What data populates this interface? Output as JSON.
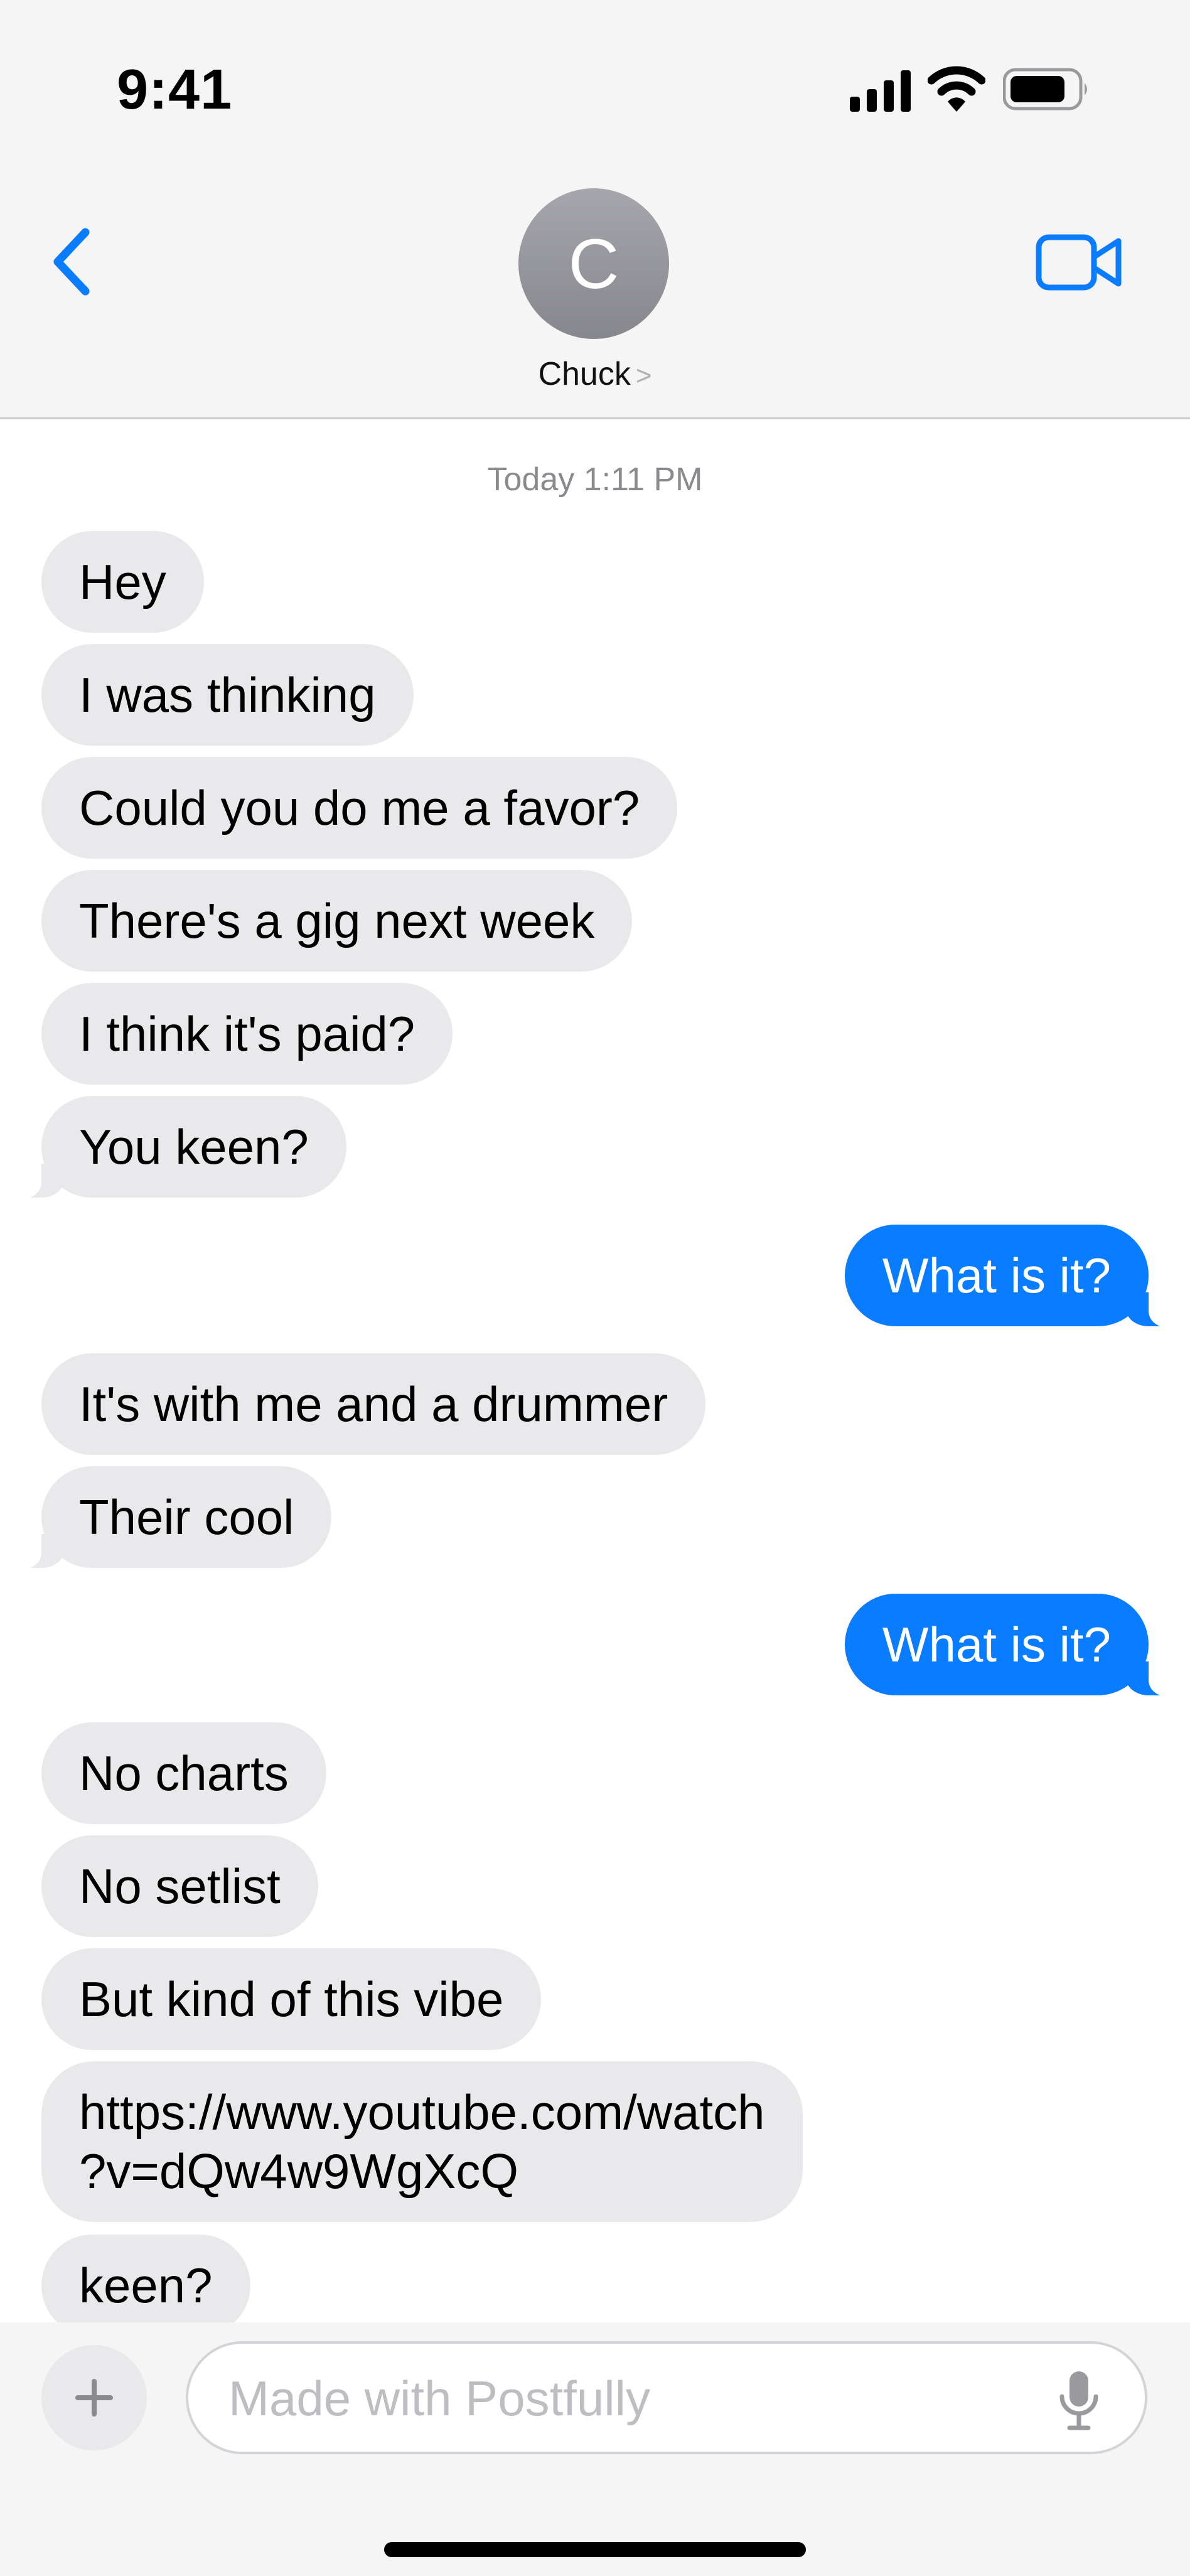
{
  "status_bar": {
    "time": "9:41"
  },
  "header": {
    "avatar_initial": "C",
    "contact_name": "Chuck",
    "contact_chevron": ">"
  },
  "thread": {
    "timestamp": "Today 1:11 PM",
    "messages": [
      {
        "from": "them",
        "text": "Hey"
      },
      {
        "from": "them",
        "text": "I was thinking"
      },
      {
        "from": "them",
        "text": "Could you do me a favor?"
      },
      {
        "from": "them",
        "text": "There's a gig next week"
      },
      {
        "from": "them",
        "text": "I think it's paid?"
      },
      {
        "from": "them",
        "text": "You keen?"
      },
      {
        "from": "me",
        "text": "What is it?"
      },
      {
        "from": "them",
        "text": "It's with me and a drummer"
      },
      {
        "from": "them",
        "text": "Their cool"
      },
      {
        "from": "me",
        "text": "What is it?"
      },
      {
        "from": "them",
        "text": "No charts"
      },
      {
        "from": "them",
        "text": "No setlist"
      },
      {
        "from": "them",
        "text": "But kind of this vibe"
      },
      {
        "from": "them",
        "text_line1": "https://www.youtube.com/watch",
        "text_line2": "?v=dQw4w9WgXcQ"
      },
      {
        "from": "them",
        "text": "keen?"
      }
    ]
  },
  "input": {
    "placeholder": "Made with Postfully"
  },
  "colors": {
    "sent_bubble": "#0a7cff",
    "received_bubble": "#e9e9eb",
    "accent": "#0a7cff"
  },
  "icons": [
    "back-chevron-icon",
    "video-call-icon",
    "plus-icon",
    "microphone-icon",
    "signal-icon",
    "wifi-icon",
    "battery-icon"
  ]
}
